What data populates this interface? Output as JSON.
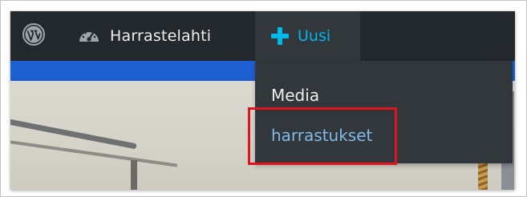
{
  "adminbar": {
    "logo_icon": "wordpress-logo-icon",
    "site": {
      "icon": "dashboard-gauge-icon",
      "name": "Harrastelahti"
    },
    "new": {
      "icon": "plus-icon",
      "label": "Uusi"
    }
  },
  "dropdown": {
    "items": [
      {
        "label": "Media"
      },
      {
        "label": "harrastukset",
        "highlighted": true
      }
    ]
  },
  "colors": {
    "adminbar_bg": "#23282d",
    "submenu_bg": "#32373c",
    "accent_blue": "#00b9eb",
    "link_blue": "#81bbea",
    "band_blue": "#1d5fd1",
    "highlight_red": "#e0141d"
  }
}
